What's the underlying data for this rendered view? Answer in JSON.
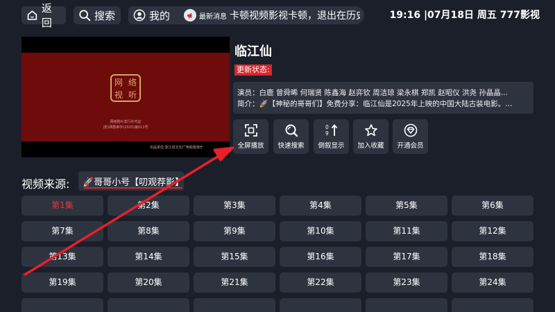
{
  "topbar": {
    "back_label": "返回",
    "search_label": "搜索",
    "mine_label": "我的",
    "news_label": "最新消息",
    "news_text": "卡顿视频影视卡顿，退出在历史",
    "clock": "19:16 |07月18日 周五   777影视"
  },
  "player": {
    "seal_chars": [
      "网",
      "络",
      "视",
      "听"
    ],
    "caption_line1": "网络剧片发行许可证",
    "caption_line2": "(影)网剧审字(2025)第011号",
    "caption_line3": "出品单位:浙江省文化广电和旅游厅"
  },
  "detail": {
    "title": "临江仙",
    "status_label": "更新状态:",
    "cast_line": "演员：白鹿 曾舜晞 何瑞贤 陈鑫海 赵弈钦 周洁琼 梁永棋 郑凯 赵昭仪 洪尧 孙晶晶...",
    "intro_line": "简介：🚀【神秘的哥哥们】免费分享：临江仙是2025年上映的中国大陆古装电影。..."
  },
  "actions": [
    {
      "label": "全屏播放",
      "icon": "fullscreen-icon"
    },
    {
      "label": "快速搜索",
      "icon": "search-icon"
    },
    {
      "label": "倒叙显示",
      "icon": "sort-icon"
    },
    {
      "label": "加入收藏",
      "icon": "star-icon"
    },
    {
      "label": "开通会员",
      "icon": "vip-diamond-icon"
    }
  ],
  "source": {
    "label": "视频来源:",
    "selected": "🚀哥哥小号【叨观荐影】"
  },
  "episodes": [
    "第1集",
    "第2集",
    "第3集",
    "第4集",
    "第5集",
    "第6集",
    "第7集",
    "第8集",
    "第9集",
    "第10集",
    "第11集",
    "第12集",
    "第13集",
    "第14集",
    "第15集",
    "第16集",
    "第17集",
    "第18集",
    "第19集",
    "第20集",
    "第21集",
    "第22集",
    "第23集",
    "第24集"
  ],
  "active_episode_index": 0,
  "colors": {
    "background": "#1b1f2a",
    "button": "#2e3340",
    "accent_red": "#d8262c",
    "active_text": "#e0393e",
    "arrow": "#e8202a"
  }
}
